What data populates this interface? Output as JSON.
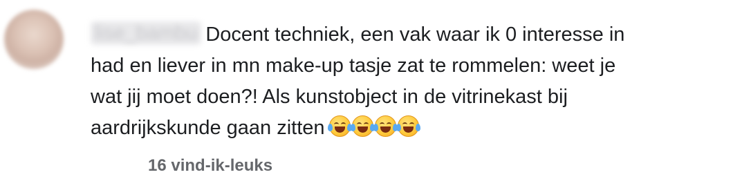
{
  "comment": {
    "username": "lise_bambu",
    "text_lines": [
      "Docent techniek, een vak waar ik 0 interesse in",
      "had en liever in mn make-up tasje zat te rommelen: weet je",
      "wat jij moet doen?! Als kunstobject in de vitrinekast bij",
      "aardrijkskunde gaan zitten"
    ],
    "emoji": [
      "😂",
      "😂",
      "😂",
      "😂"
    ],
    "emoji_icon_name": "face-with-tears-of-joy-icon",
    "likes_label": "16 vind-ik-leuks"
  },
  "colors": {
    "text": "#1c1e21",
    "secondary_text": "#65676b",
    "background": "#ffffff"
  }
}
